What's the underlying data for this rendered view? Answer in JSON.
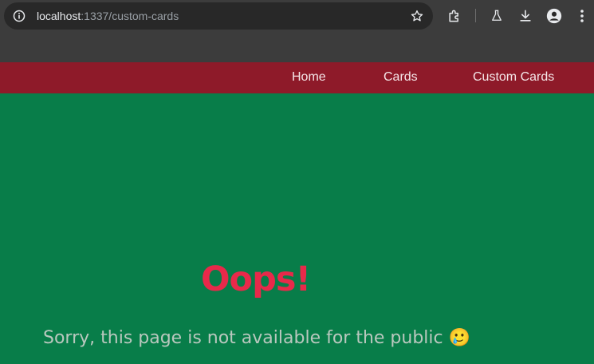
{
  "browser": {
    "url_host": "localhost",
    "url_path": ":1337/custom-cards",
    "icons": [
      "site-info-icon",
      "bookmark-star-icon",
      "extensions-icon",
      "labs-flask-icon",
      "download-icon",
      "profile-icon",
      "kebab-menu-icon"
    ]
  },
  "nav": {
    "items": [
      {
        "label": "Home"
      },
      {
        "label": "Cards"
      },
      {
        "label": "Custom Cards"
      }
    ]
  },
  "main": {
    "title": "Oops!",
    "message": "Sorry, this page is not available for the public",
    "emoji": "🥲"
  },
  "colors": {
    "page_background": "#087d49",
    "navbar_background": "#8e1a29",
    "title": "#e8294a",
    "message": "#b9c8be"
  }
}
